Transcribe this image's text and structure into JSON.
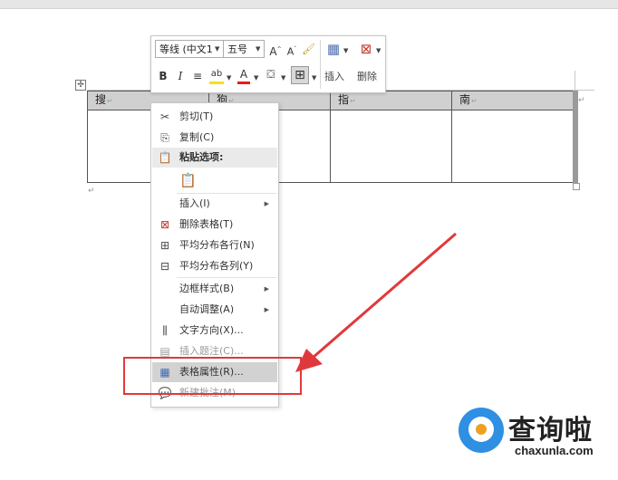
{
  "table": {
    "headers": [
      "搜",
      "狗",
      "指",
      "南"
    ]
  },
  "mini_toolbar": {
    "font_name": "等线 (中文1",
    "font_size": "五号",
    "insert_label": "插入",
    "delete_label": "删除"
  },
  "context_menu": {
    "cut": "剪切(T)",
    "copy": "复制(C)",
    "paste_options": "粘贴选项:",
    "insert": "插入(I)",
    "delete_table": "删除表格(T)",
    "distribute_rows": "平均分布各行(N)",
    "distribute_cols": "平均分布各列(Y)",
    "border_styles": "边框样式(B)",
    "autofit": "自动调整(A)",
    "text_direction": "文字方向(X)...",
    "insert_caption": "插入题注(C)...",
    "table_properties": "表格属性(R)...",
    "new_comment": "新建批注(M)"
  },
  "watermark": {
    "name": "查询啦",
    "url": "chaxunla.com"
  },
  "colors": {
    "annotation_red": "#e0393b",
    "logo_blue": "#2f8fe3",
    "logo_orange": "#f0a020",
    "header_fill": "#d0d0d0"
  }
}
